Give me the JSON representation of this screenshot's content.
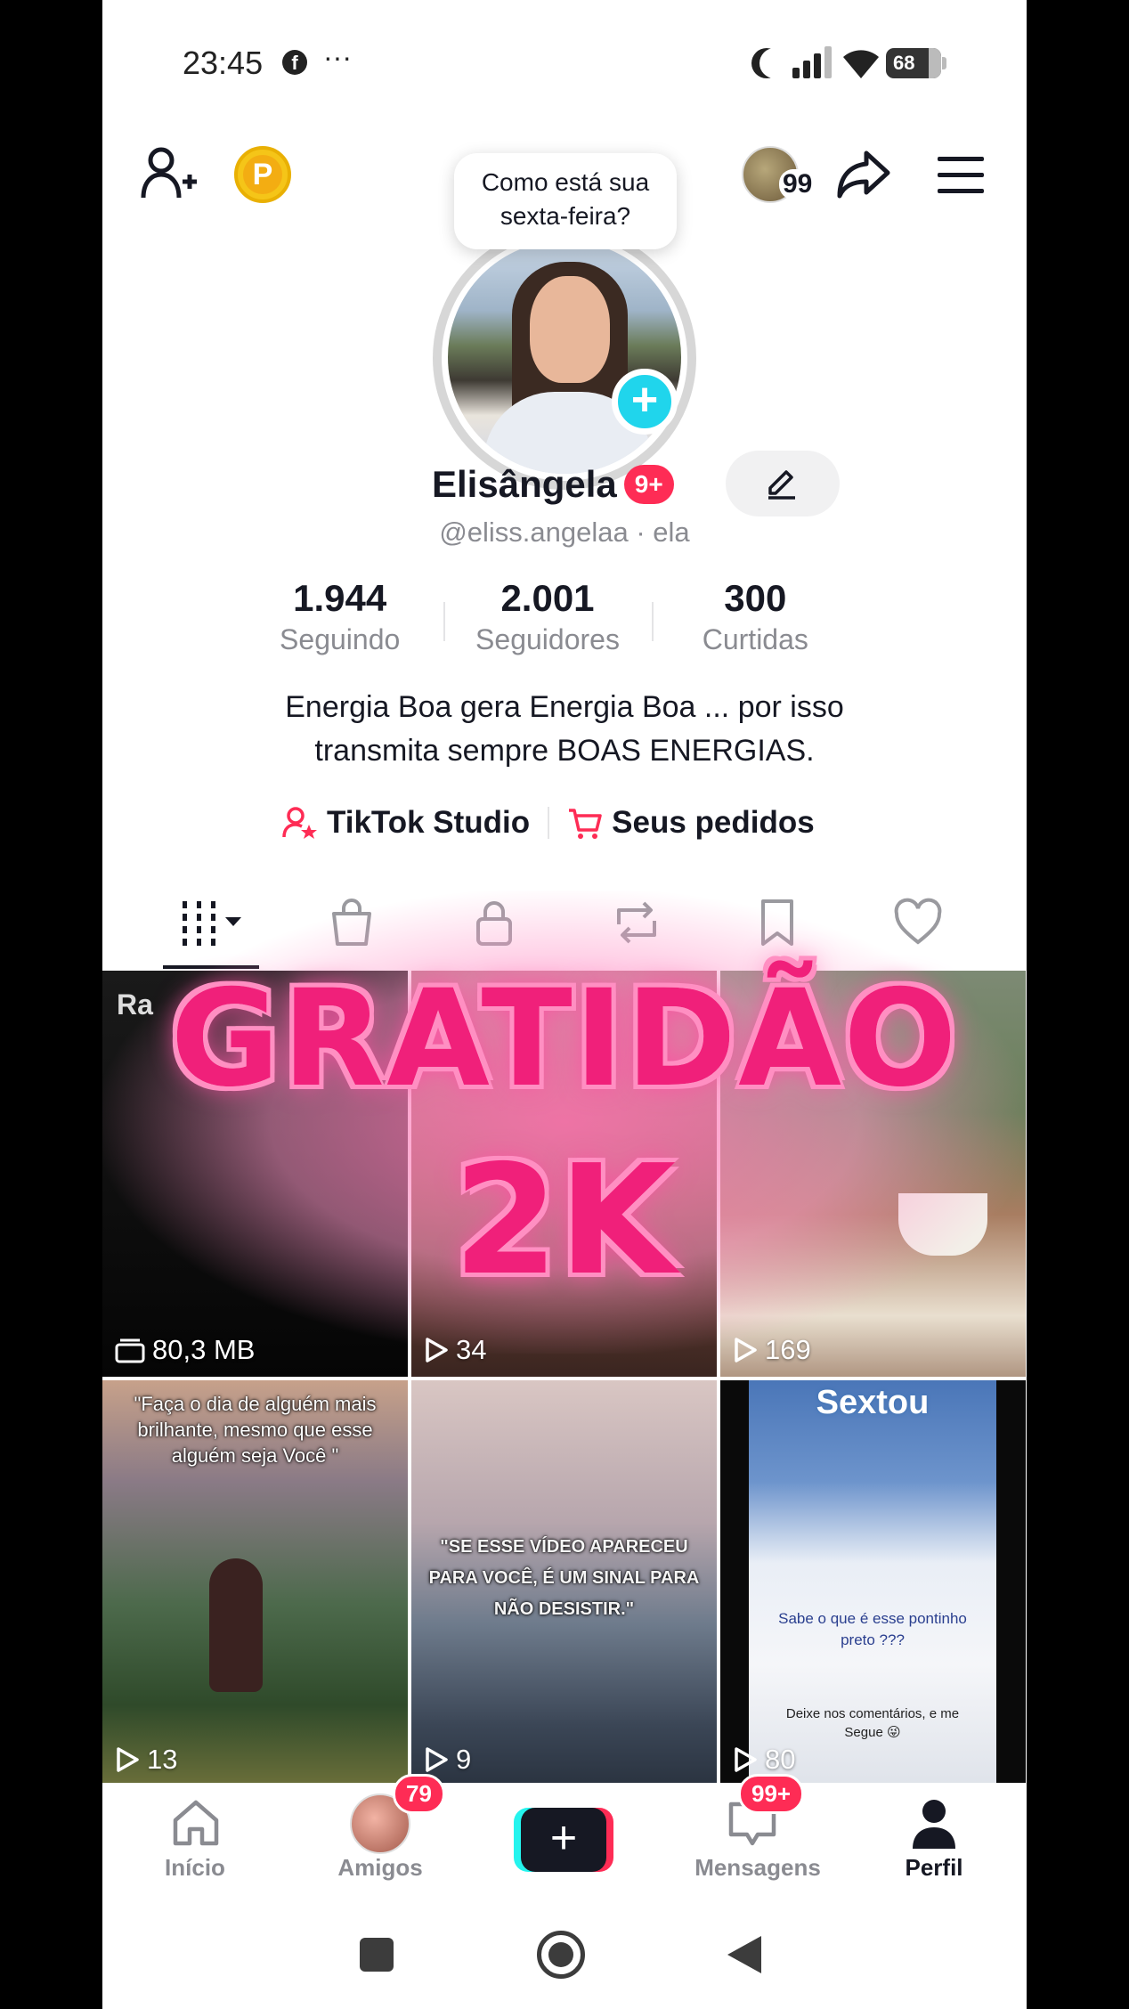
{
  "status_bar": {
    "time": "23:45",
    "more": "···",
    "battery": "68"
  },
  "top_nav": {
    "avatar_count": "99"
  },
  "tooltip": {
    "line1": "Como está sua",
    "line2": "sexta-feira?"
  },
  "profile": {
    "name": "Elisângela",
    "notif_badge": "9+",
    "handle": "@eliss.angelaa · ela",
    "stats": [
      {
        "value": "1.944",
        "label": "Seguindo"
      },
      {
        "value": "2.001",
        "label": "Seguidores"
      },
      {
        "value": "300",
        "label": "Curtidas"
      }
    ],
    "bio_line1": "Energia Boa gera Energia Boa ... por isso",
    "bio_line2": "transmita sempre BOAS ENERGIAS."
  },
  "links": {
    "studio": "TikTok Studio",
    "orders": "Seus pedidos"
  },
  "grid": {
    "first_label": "Ra",
    "items": [
      {
        "count": "80,3 MB",
        "type": "draft"
      },
      {
        "count": "34",
        "type": "play"
      },
      {
        "count": "169",
        "type": "play"
      },
      {
        "count": "13",
        "type": "play",
        "caption": "\"Faça o dia de alguém mais brilhante, mesmo que esse alguém seja Você \""
      },
      {
        "count": "9",
        "type": "play",
        "caption": "\"SE ESSE VÍDEO APARECEU PARA VOCÊ, É UM SINAL PARA NÃO DESISTIR.\""
      },
      {
        "count": "80",
        "type": "play",
        "title": "Sextou",
        "caption": "Sabe o que é esse pontinho preto ???",
        "caption2": "Deixe nos comentários, e me Segue 😜"
      }
    ]
  },
  "overlay": {
    "line1": "GRATIDÃO",
    "line2": "2K"
  },
  "bottom_nav": {
    "home": "Início",
    "friends": "Amigos",
    "friends_badge": "79",
    "messages": "Mensagens",
    "messages_badge": "99+",
    "profile": "Perfil"
  },
  "colors": {
    "accent": "#fe2c55",
    "cyan": "#20d5ec",
    "overlay_pink": "#f0207a"
  }
}
